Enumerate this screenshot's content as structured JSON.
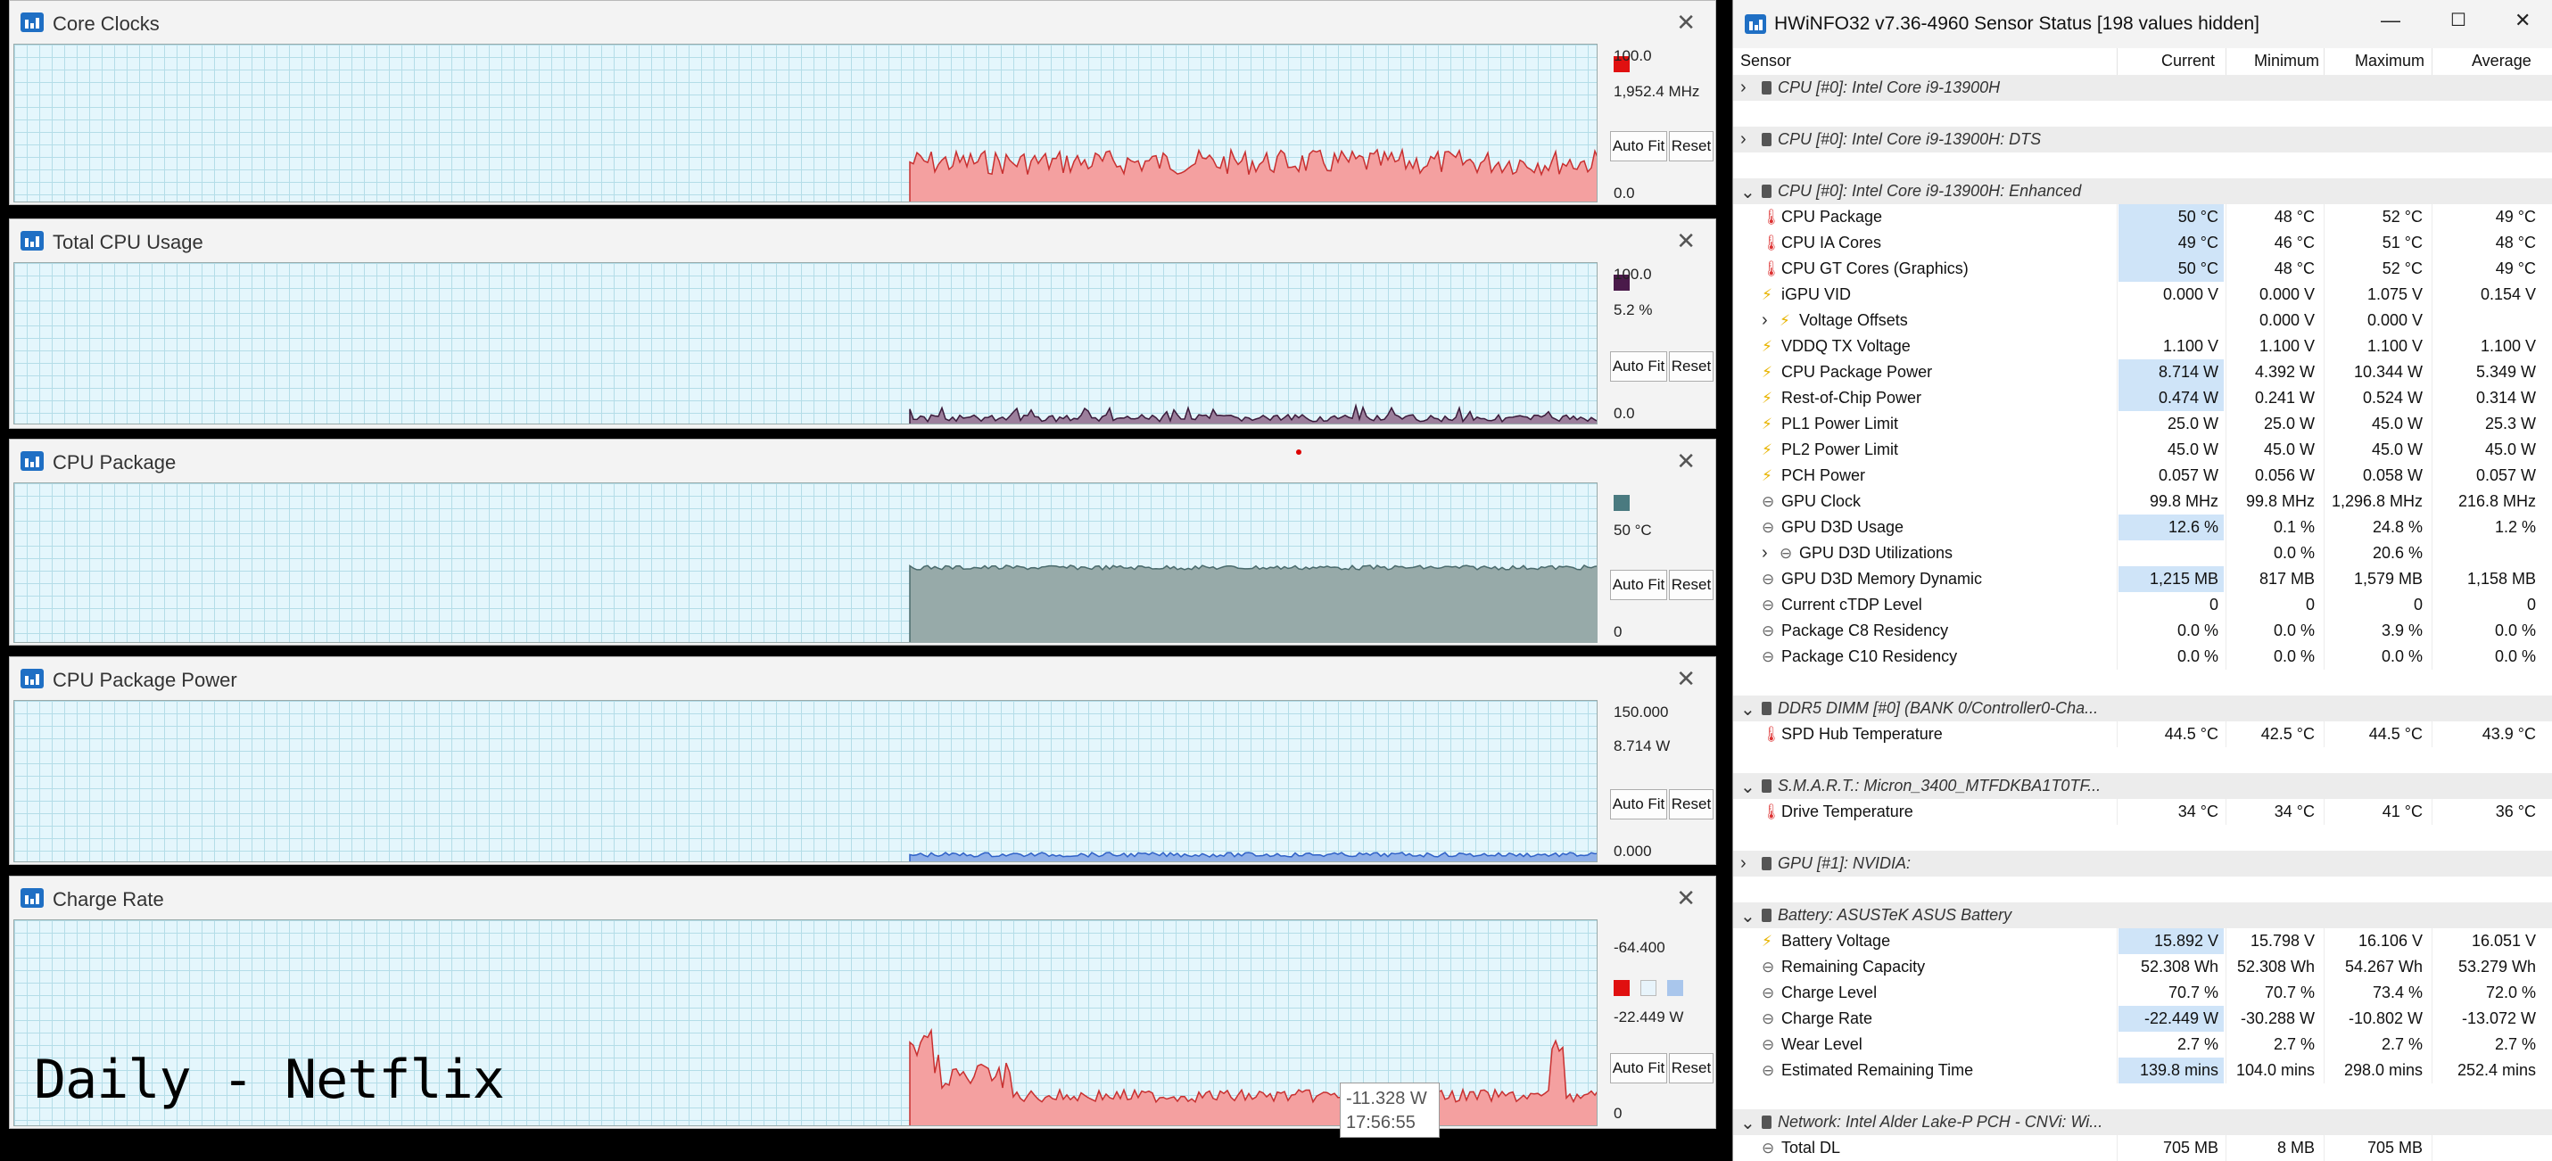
{
  "graphs": [
    {
      "title": "Core Clocks",
      "max": "100.0",
      "current": "1,952.4 MHz",
      "min": "0.0",
      "auto_fit": "Auto Fit",
      "reset": "Reset",
      "color": "#f08080",
      "swatch": "#e01010"
    },
    {
      "title": "Total CPU Usage",
      "max": "100.0",
      "current": "5.2 %",
      "min": "0.0",
      "auto_fit": "Auto Fit",
      "reset": "Reset",
      "color": "#5a3a5a",
      "swatch": "#4a1a4a"
    },
    {
      "title": "CPU Package",
      "max": "",
      "current": "50 °C",
      "min": "0",
      "auto_fit": "Auto Fit",
      "reset": "Reset",
      "color": "#7a9a9c",
      "swatch": "#4a7a80"
    },
    {
      "title": "CPU Package Power",
      "max": "150.000",
      "current": "8.714 W",
      "min": "0.000",
      "auto_fit": "Auto Fit",
      "reset": "Reset",
      "color": "#5a8ad8",
      "swatch": "#5a8ad8"
    },
    {
      "title": "Charge Rate",
      "max": "-64.400",
      "current": "-22.449 W",
      "min": "0",
      "auto_fit": "Auto Fit",
      "reset": "Reset",
      "color": "#f08080",
      "swatch": "#e01010"
    }
  ],
  "overlay_text": "Daily - Netflix",
  "tooltip": {
    "value": "-11.328 W",
    "time": "17:56:55"
  },
  "sensor_window": {
    "title": "HWiNFO32 v7.36-4960 Sensor Status [198 values hidden]",
    "columns": {
      "sensor": "Sensor",
      "current": "Current",
      "minimum": "Minimum",
      "maximum": "Maximum",
      "average": "Average"
    },
    "rows": [
      {
        "type": "group",
        "label": "CPU [#0]: Intel Core i9-13900H",
        "expanded": false
      },
      {
        "type": "blank"
      },
      {
        "type": "group",
        "label": "CPU [#0]: Intel Core i9-13900H: DTS",
        "expanded": false
      },
      {
        "type": "blank"
      },
      {
        "type": "group",
        "label": "CPU [#0]: Intel Core i9-13900H: Enhanced",
        "expanded": true
      },
      {
        "type": "sensor",
        "icon": "therm",
        "label": "CPU Package",
        "cur": "50 °C",
        "min": "48 °C",
        "max": "52 °C",
        "avg": "49 °C",
        "hl": true
      },
      {
        "type": "sensor",
        "icon": "therm",
        "label": "CPU IA Cores",
        "cur": "49 °C",
        "min": "46 °C",
        "max": "51 °C",
        "avg": "48 °C",
        "hl": true
      },
      {
        "type": "sensor",
        "icon": "therm",
        "label": "CPU GT Cores (Graphics)",
        "cur": "50 °C",
        "min": "48 °C",
        "max": "52 °C",
        "avg": "49 °C",
        "hl": true
      },
      {
        "type": "sensor",
        "icon": "bolt",
        "label": "iGPU VID",
        "cur": "0.000 V",
        "min": "0.000 V",
        "max": "1.075 V",
        "avg": "0.154 V"
      },
      {
        "type": "sub",
        "icon": "bolt",
        "label": "Voltage Offsets",
        "cur": "",
        "min": "0.000 V",
        "max": "0.000 V",
        "avg": ""
      },
      {
        "type": "sensor",
        "icon": "bolt",
        "label": "VDDQ TX Voltage",
        "cur": "1.100 V",
        "min": "1.100 V",
        "max": "1.100 V",
        "avg": "1.100 V"
      },
      {
        "type": "sensor",
        "icon": "bolt",
        "label": "CPU Package Power",
        "cur": "8.714 W",
        "min": "4.392 W",
        "max": "10.344 W",
        "avg": "5.349 W",
        "hl": true
      },
      {
        "type": "sensor",
        "icon": "bolt",
        "label": "Rest-of-Chip Power",
        "cur": "0.474 W",
        "min": "0.241 W",
        "max": "0.524 W",
        "avg": "0.314 W",
        "hl": true
      },
      {
        "type": "sensor",
        "icon": "bolt",
        "label": "PL1 Power Limit",
        "cur": "25.0 W",
        "min": "25.0 W",
        "max": "45.0 W",
        "avg": "25.3 W"
      },
      {
        "type": "sensor",
        "icon": "bolt",
        "label": "PL2 Power Limit",
        "cur": "45.0 W",
        "min": "45.0 W",
        "max": "45.0 W",
        "avg": "45.0 W"
      },
      {
        "type": "sensor",
        "icon": "bolt",
        "label": "PCH Power",
        "cur": "0.057 W",
        "min": "0.056 W",
        "max": "0.058 W",
        "avg": "0.057 W"
      },
      {
        "type": "sensor",
        "icon": "circ",
        "label": "GPU Clock",
        "cur": "99.8 MHz",
        "min": "99.8 MHz",
        "max": "1,296.8 MHz",
        "avg": "216.8 MHz"
      },
      {
        "type": "sensor",
        "icon": "circ",
        "label": "GPU D3D Usage",
        "cur": "12.6 %",
        "min": "0.1 %",
        "max": "24.8 %",
        "avg": "1.2 %",
        "hl": true
      },
      {
        "type": "sub",
        "icon": "circ",
        "label": "GPU D3D Utilizations",
        "cur": "",
        "min": "0.0 %",
        "max": "20.6 %",
        "avg": ""
      },
      {
        "type": "sensor",
        "icon": "circ",
        "label": "GPU D3D Memory Dynamic",
        "cur": "1,215 MB",
        "min": "817 MB",
        "max": "1,579 MB",
        "avg": "1,158 MB",
        "hl": true
      },
      {
        "type": "sensor",
        "icon": "circ",
        "label": "Current cTDP Level",
        "cur": "0",
        "min": "0",
        "max": "0",
        "avg": "0"
      },
      {
        "type": "sensor",
        "icon": "circ",
        "label": "Package C8 Residency",
        "cur": "0.0 %",
        "min": "0.0 %",
        "max": "3.9 %",
        "avg": "0.0 %"
      },
      {
        "type": "sensor",
        "icon": "circ",
        "label": "Package C10 Residency",
        "cur": "0.0 %",
        "min": "0.0 %",
        "max": "0.0 %",
        "avg": "0.0 %"
      },
      {
        "type": "blank"
      },
      {
        "type": "group",
        "label": "DDR5 DIMM [#0] (BANK 0/Controller0-Cha...",
        "expanded": true
      },
      {
        "type": "sensor",
        "icon": "therm",
        "label": "SPD Hub Temperature",
        "cur": "44.5 °C",
        "min": "42.5 °C",
        "max": "44.5 °C",
        "avg": "43.9 °C"
      },
      {
        "type": "blank"
      },
      {
        "type": "group",
        "label": "S.M.A.R.T.: Micron_3400_MTFDKBA1T0TF...",
        "expanded": true
      },
      {
        "type": "sensor",
        "icon": "therm",
        "label": "Drive Temperature",
        "cur": "34 °C",
        "min": "34 °C",
        "max": "41 °C",
        "avg": "36 °C"
      },
      {
        "type": "blank"
      },
      {
        "type": "group",
        "label": "GPU [#1]: NVIDIA:",
        "expanded": false
      },
      {
        "type": "blank"
      },
      {
        "type": "group",
        "label": "Battery: ASUSTeK ASUS Battery",
        "expanded": true
      },
      {
        "type": "sensor",
        "icon": "bolt",
        "label": "Battery Voltage",
        "cur": "15.892 V",
        "min": "15.798 V",
        "max": "16.106 V",
        "avg": "16.051 V",
        "hl": true
      },
      {
        "type": "sensor",
        "icon": "circ",
        "label": "Remaining Capacity",
        "cur": "52.308 Wh",
        "min": "52.308 Wh",
        "max": "54.267 Wh",
        "avg": "53.279 Wh"
      },
      {
        "type": "sensor",
        "icon": "circ",
        "label": "Charge Level",
        "cur": "70.7 %",
        "min": "70.7 %",
        "max": "73.4 %",
        "avg": "72.0 %"
      },
      {
        "type": "sensor",
        "icon": "circ",
        "label": "Charge Rate",
        "cur": "-22.449 W",
        "min": "-30.288 W",
        "max": "-10.802 W",
        "avg": "-13.072 W",
        "hl": true
      },
      {
        "type": "sensor",
        "icon": "circ",
        "label": "Wear Level",
        "cur": "2.7 %",
        "min": "2.7 %",
        "max": "2.7 %",
        "avg": "2.7 %"
      },
      {
        "type": "sensor",
        "icon": "circ",
        "label": "Estimated Remaining Time",
        "cur": "139.8 mins",
        "min": "104.0 mins",
        "max": "298.0 mins",
        "avg": "252.4 mins",
        "hl": true
      },
      {
        "type": "blank"
      },
      {
        "type": "group",
        "label": "Network: Intel Alder Lake-P PCH - CNVi: Wi...",
        "expanded": true
      },
      {
        "type": "sensor",
        "icon": "circ",
        "label": "Total DL",
        "cur": "705 MB",
        "min": "8 MB",
        "max": "705 MB",
        "avg": ""
      }
    ]
  }
}
